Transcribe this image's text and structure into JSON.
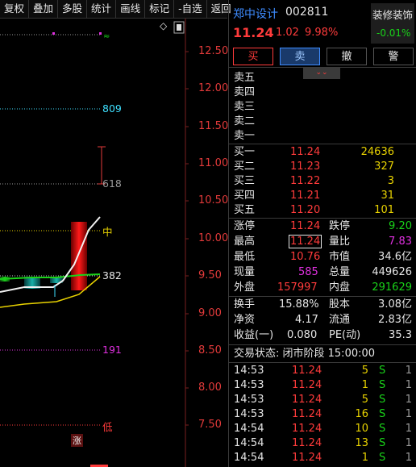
{
  "toolbar": [
    "复权",
    "叠加",
    "多股",
    "统计",
    "画线",
    "标记",
    "-自选",
    "返回"
  ],
  "chart": {
    "price_labels": [
      "12.50",
      "12.00",
      "11.50",
      "11.00",
      "10.50",
      "10.00",
      "9.50",
      "9.00",
      "8.50",
      "8.00",
      "7.50"
    ],
    "levels": [
      {
        "label": "809",
        "color": "#3ee0ff"
      },
      {
        "label": "618",
        "color": "#9a9a9a"
      },
      {
        "label": "中",
        "color": "#e8d200"
      },
      {
        "label": "382",
        "color": "#c8c8c8"
      },
      {
        "label": "191",
        "color": "#e030e0"
      },
      {
        "label": "低",
        "color": "#ff3b3b"
      }
    ],
    "zhang_mark": "涨",
    "diamond": "◇"
  },
  "stock": {
    "name": "郑中设计",
    "code": "002811",
    "price": "11.24",
    "change": "1.02",
    "pct": "9.98%",
    "sector_name": "装修装饰",
    "sector_pct": "-0.01%"
  },
  "buttons": {
    "buy": "买",
    "sell": "卖",
    "cancel": "撤",
    "alert": "警"
  },
  "expand_icon": "⌄⌄",
  "asks": [
    {
      "label": "卖五"
    },
    {
      "label": "卖四"
    },
    {
      "label": "卖三"
    },
    {
      "label": "卖二"
    },
    {
      "label": "卖一"
    }
  ],
  "bids": [
    {
      "label": "买一",
      "price": "11.24",
      "vol": "24636"
    },
    {
      "label": "买二",
      "price": "11.23",
      "vol": "327"
    },
    {
      "label": "买三",
      "price": "11.22",
      "vol": "3"
    },
    {
      "label": "买四",
      "price": "11.21",
      "vol": "31"
    },
    {
      "label": "买五",
      "price": "11.20",
      "vol": "101"
    }
  ],
  "stats": {
    "zt_label": "涨停",
    "zt": "11.24",
    "dt_label": "跌停",
    "dt": "9.20",
    "high_label": "最高",
    "high": "11.24",
    "lb_label": "量比",
    "lb": "7.83",
    "low_label": "最低",
    "low": "10.76",
    "sz_label": "市值",
    "sz": "34.6亿",
    "xl_label": "现量",
    "xl": "585",
    "zl_label": "总量",
    "zl": "449626",
    "wp_label": "外盘",
    "wp": "157997",
    "np_label": "内盘",
    "np": "291629",
    "hs_label": "换手",
    "hs": "15.88%",
    "gb_label": "股本",
    "gb": "3.08亿",
    "jz_label": "净资",
    "jz": "4.17",
    "lt_label": "流通",
    "lt": "2.83亿",
    "sy_label": "收益(一)",
    "sy": "0.080",
    "pe_label": "PE(动)",
    "pe": "35.3"
  },
  "trade_status": "交易状态: 闭市阶段 15:00:00",
  "ticks": [
    {
      "time": "14:53",
      "price": "11.24",
      "vol": "5",
      "side": "S",
      "n": "1"
    },
    {
      "time": "14:53",
      "price": "11.24",
      "vol": "1",
      "side": "S",
      "n": "1"
    },
    {
      "time": "14:53",
      "price": "11.24",
      "vol": "5",
      "side": "S",
      "n": "1"
    },
    {
      "time": "14:53",
      "price": "11.24",
      "vol": "16",
      "side": "S",
      "n": "1"
    },
    {
      "time": "14:54",
      "price": "11.24",
      "vol": "10",
      "side": "S",
      "n": "1"
    },
    {
      "time": "14:54",
      "price": "11.24",
      "vol": "13",
      "side": "S",
      "n": "1"
    },
    {
      "time": "14:54",
      "price": "11.24",
      "vol": "1",
      "side": "S",
      "n": "1"
    }
  ]
}
